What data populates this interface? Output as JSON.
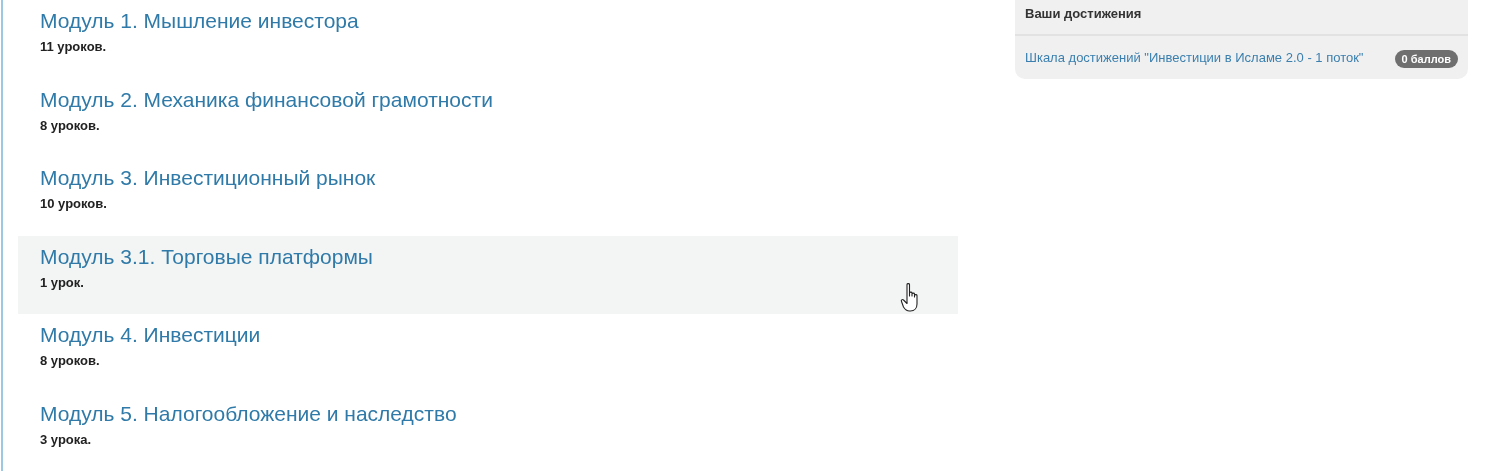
{
  "modules": [
    {
      "title": "Модуль 1. Мышление инвестора",
      "lessons": "11 уроков.",
      "hovered": false
    },
    {
      "title": "Модуль 2. Механика финансовой грамотности",
      "lessons": "8 уроков.",
      "hovered": false
    },
    {
      "title": "Модуль 3. Инвестиционный рынок",
      "lessons": "10 уроков.",
      "hovered": false
    },
    {
      "title": "Модуль 3.1. Торговые платформы",
      "lessons": "1 урок.",
      "hovered": true
    },
    {
      "title": "Модуль 4. Инвестиции",
      "lessons": "8 уроков.",
      "hovered": false
    },
    {
      "title": "Модуль 5. Налогообложение и наследство",
      "lessons": "3 урока.",
      "hovered": false
    }
  ],
  "achievements": {
    "title": "Ваши достижения",
    "items": [
      {
        "name": "Шкала достижений \"Инвестиции в Исламе 2.0 - 1 поток\"",
        "points": "0 баллов"
      }
    ]
  }
}
